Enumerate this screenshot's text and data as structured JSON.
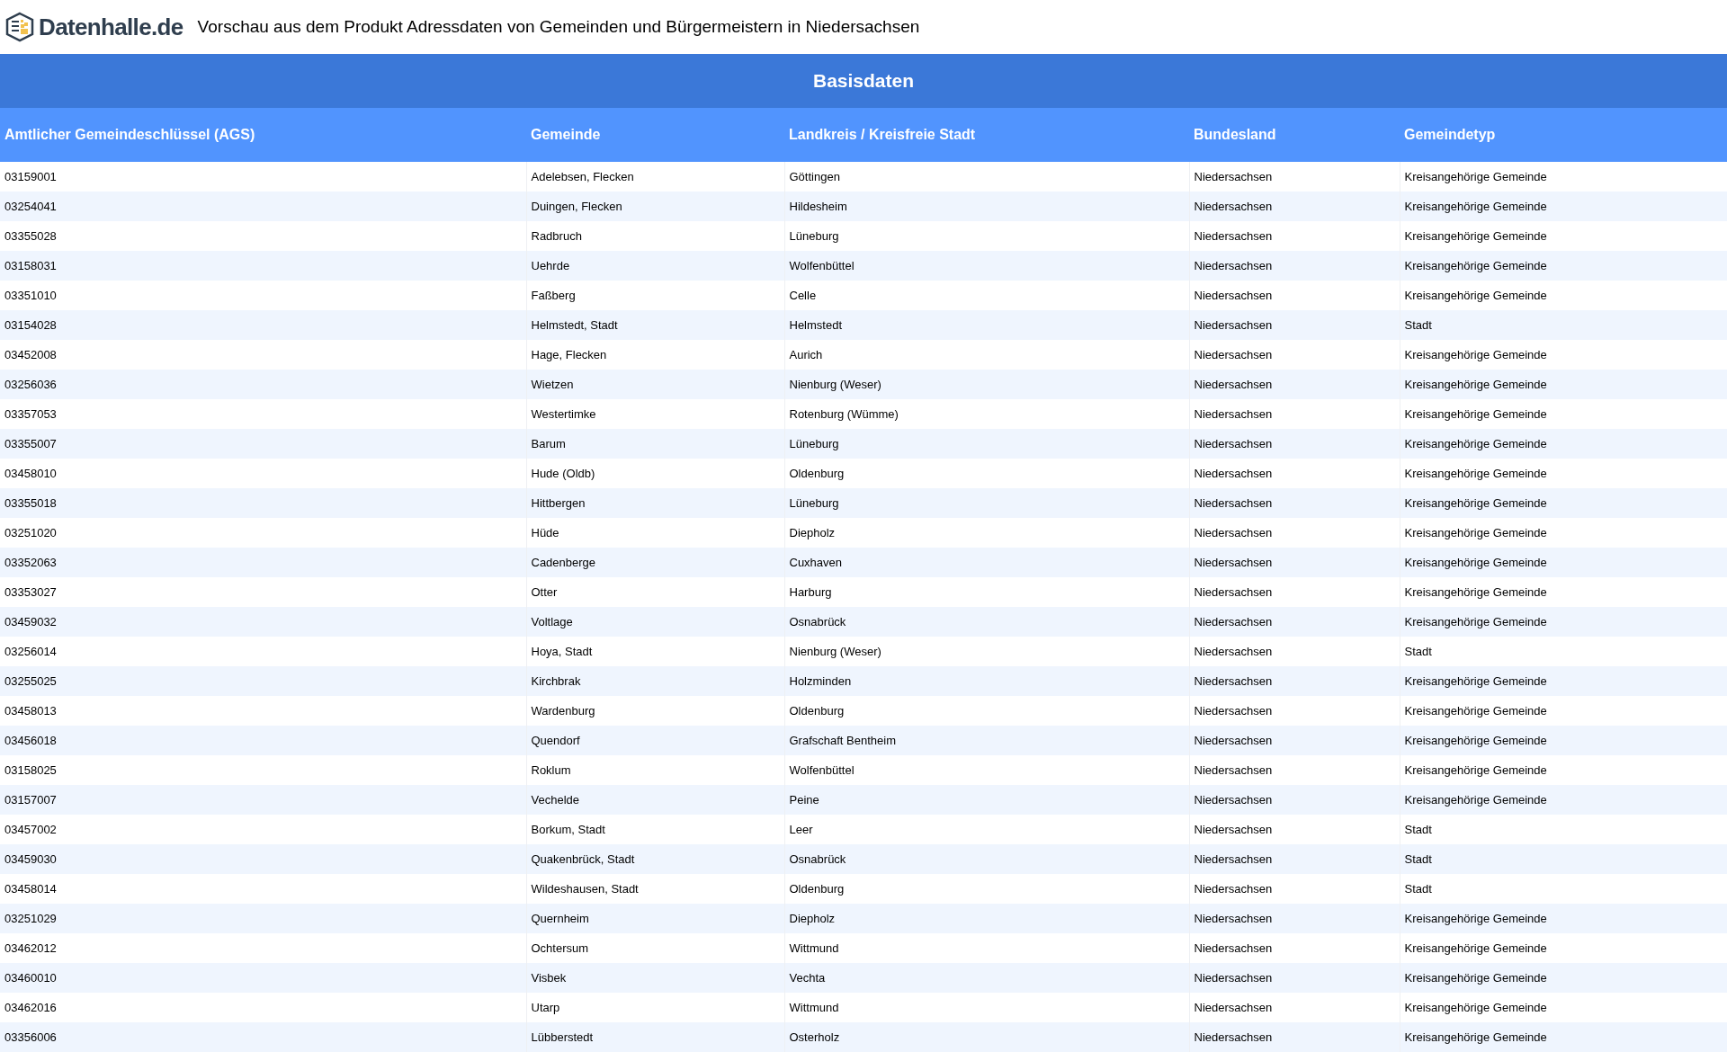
{
  "header": {
    "logo_text": "Datenhalle.de",
    "title": "Vorschau aus dem Produkt Adressdaten von Gemeinden und Bürgermeistern in Niedersachsen"
  },
  "section_title": "Basisdaten",
  "table": {
    "columns": [
      "Amtlicher Gemeindeschlüssel (AGS)",
      "Gemeinde",
      "Landkreis / Kreisfreie Stadt",
      "Bundesland",
      "Gemeindetyp"
    ],
    "rows": [
      [
        "03159001",
        "Adelebsen, Flecken",
        "Göttingen",
        "Niedersachsen",
        "Kreisangehörige Gemeinde"
      ],
      [
        "03254041",
        "Duingen, Flecken",
        "Hildesheim",
        "Niedersachsen",
        "Kreisangehörige Gemeinde"
      ],
      [
        "03355028",
        "Radbruch",
        "Lüneburg",
        "Niedersachsen",
        "Kreisangehörige Gemeinde"
      ],
      [
        "03158031",
        "Uehrde",
        "Wolfenbüttel",
        "Niedersachsen",
        "Kreisangehörige Gemeinde"
      ],
      [
        "03351010",
        "Faßberg",
        "Celle",
        "Niedersachsen",
        "Kreisangehörige Gemeinde"
      ],
      [
        "03154028",
        "Helmstedt, Stadt",
        "Helmstedt",
        "Niedersachsen",
        "Stadt"
      ],
      [
        "03452008",
        "Hage, Flecken",
        "Aurich",
        "Niedersachsen",
        "Kreisangehörige Gemeinde"
      ],
      [
        "03256036",
        "Wietzen",
        "Nienburg (Weser)",
        "Niedersachsen",
        "Kreisangehörige Gemeinde"
      ],
      [
        "03357053",
        "Westertimke",
        "Rotenburg (Wümme)",
        "Niedersachsen",
        "Kreisangehörige Gemeinde"
      ],
      [
        "03355007",
        "Barum",
        "Lüneburg",
        "Niedersachsen",
        "Kreisangehörige Gemeinde"
      ],
      [
        "03458010",
        "Hude (Oldb)",
        "Oldenburg",
        "Niedersachsen",
        "Kreisangehörige Gemeinde"
      ],
      [
        "03355018",
        "Hittbergen",
        "Lüneburg",
        "Niedersachsen",
        "Kreisangehörige Gemeinde"
      ],
      [
        "03251020",
        "Hüde",
        "Diepholz",
        "Niedersachsen",
        "Kreisangehörige Gemeinde"
      ],
      [
        "03352063",
        "Cadenberge",
        "Cuxhaven",
        "Niedersachsen",
        "Kreisangehörige Gemeinde"
      ],
      [
        "03353027",
        "Otter",
        "Harburg",
        "Niedersachsen",
        "Kreisangehörige Gemeinde"
      ],
      [
        "03459032",
        "Voltlage",
        "Osnabrück",
        "Niedersachsen",
        "Kreisangehörige Gemeinde"
      ],
      [
        "03256014",
        "Hoya, Stadt",
        "Nienburg (Weser)",
        "Niedersachsen",
        "Stadt"
      ],
      [
        "03255025",
        "Kirchbrak",
        "Holzminden",
        "Niedersachsen",
        "Kreisangehörige Gemeinde"
      ],
      [
        "03458013",
        "Wardenburg",
        "Oldenburg",
        "Niedersachsen",
        "Kreisangehörige Gemeinde"
      ],
      [
        "03456018",
        "Quendorf",
        "Grafschaft Bentheim",
        "Niedersachsen",
        "Kreisangehörige Gemeinde"
      ],
      [
        "03158025",
        "Roklum",
        "Wolfenbüttel",
        "Niedersachsen",
        "Kreisangehörige Gemeinde"
      ],
      [
        "03157007",
        "Vechelde",
        "Peine",
        "Niedersachsen",
        "Kreisangehörige Gemeinde"
      ],
      [
        "03457002",
        "Borkum, Stadt",
        "Leer",
        "Niedersachsen",
        "Stadt"
      ],
      [
        "03459030",
        "Quakenbrück, Stadt",
        "Osnabrück",
        "Niedersachsen",
        "Stadt"
      ],
      [
        "03458014",
        "Wildeshausen, Stadt",
        "Oldenburg",
        "Niedersachsen",
        "Stadt"
      ],
      [
        "03251029",
        "Quernheim",
        "Diepholz",
        "Niedersachsen",
        "Kreisangehörige Gemeinde"
      ],
      [
        "03462012",
        "Ochtersum",
        "Wittmund",
        "Niedersachsen",
        "Kreisangehörige Gemeinde"
      ],
      [
        "03460010",
        "Visbek",
        "Vechta",
        "Niedersachsen",
        "Kreisangehörige Gemeinde"
      ],
      [
        "03462016",
        "Utarp",
        "Wittmund",
        "Niedersachsen",
        "Kreisangehörige Gemeinde"
      ],
      [
        "03356006",
        "Lübberstedt",
        "Osterholz",
        "Niedersachsen",
        "Kreisangehörige Gemeinde"
      ]
    ]
  }
}
